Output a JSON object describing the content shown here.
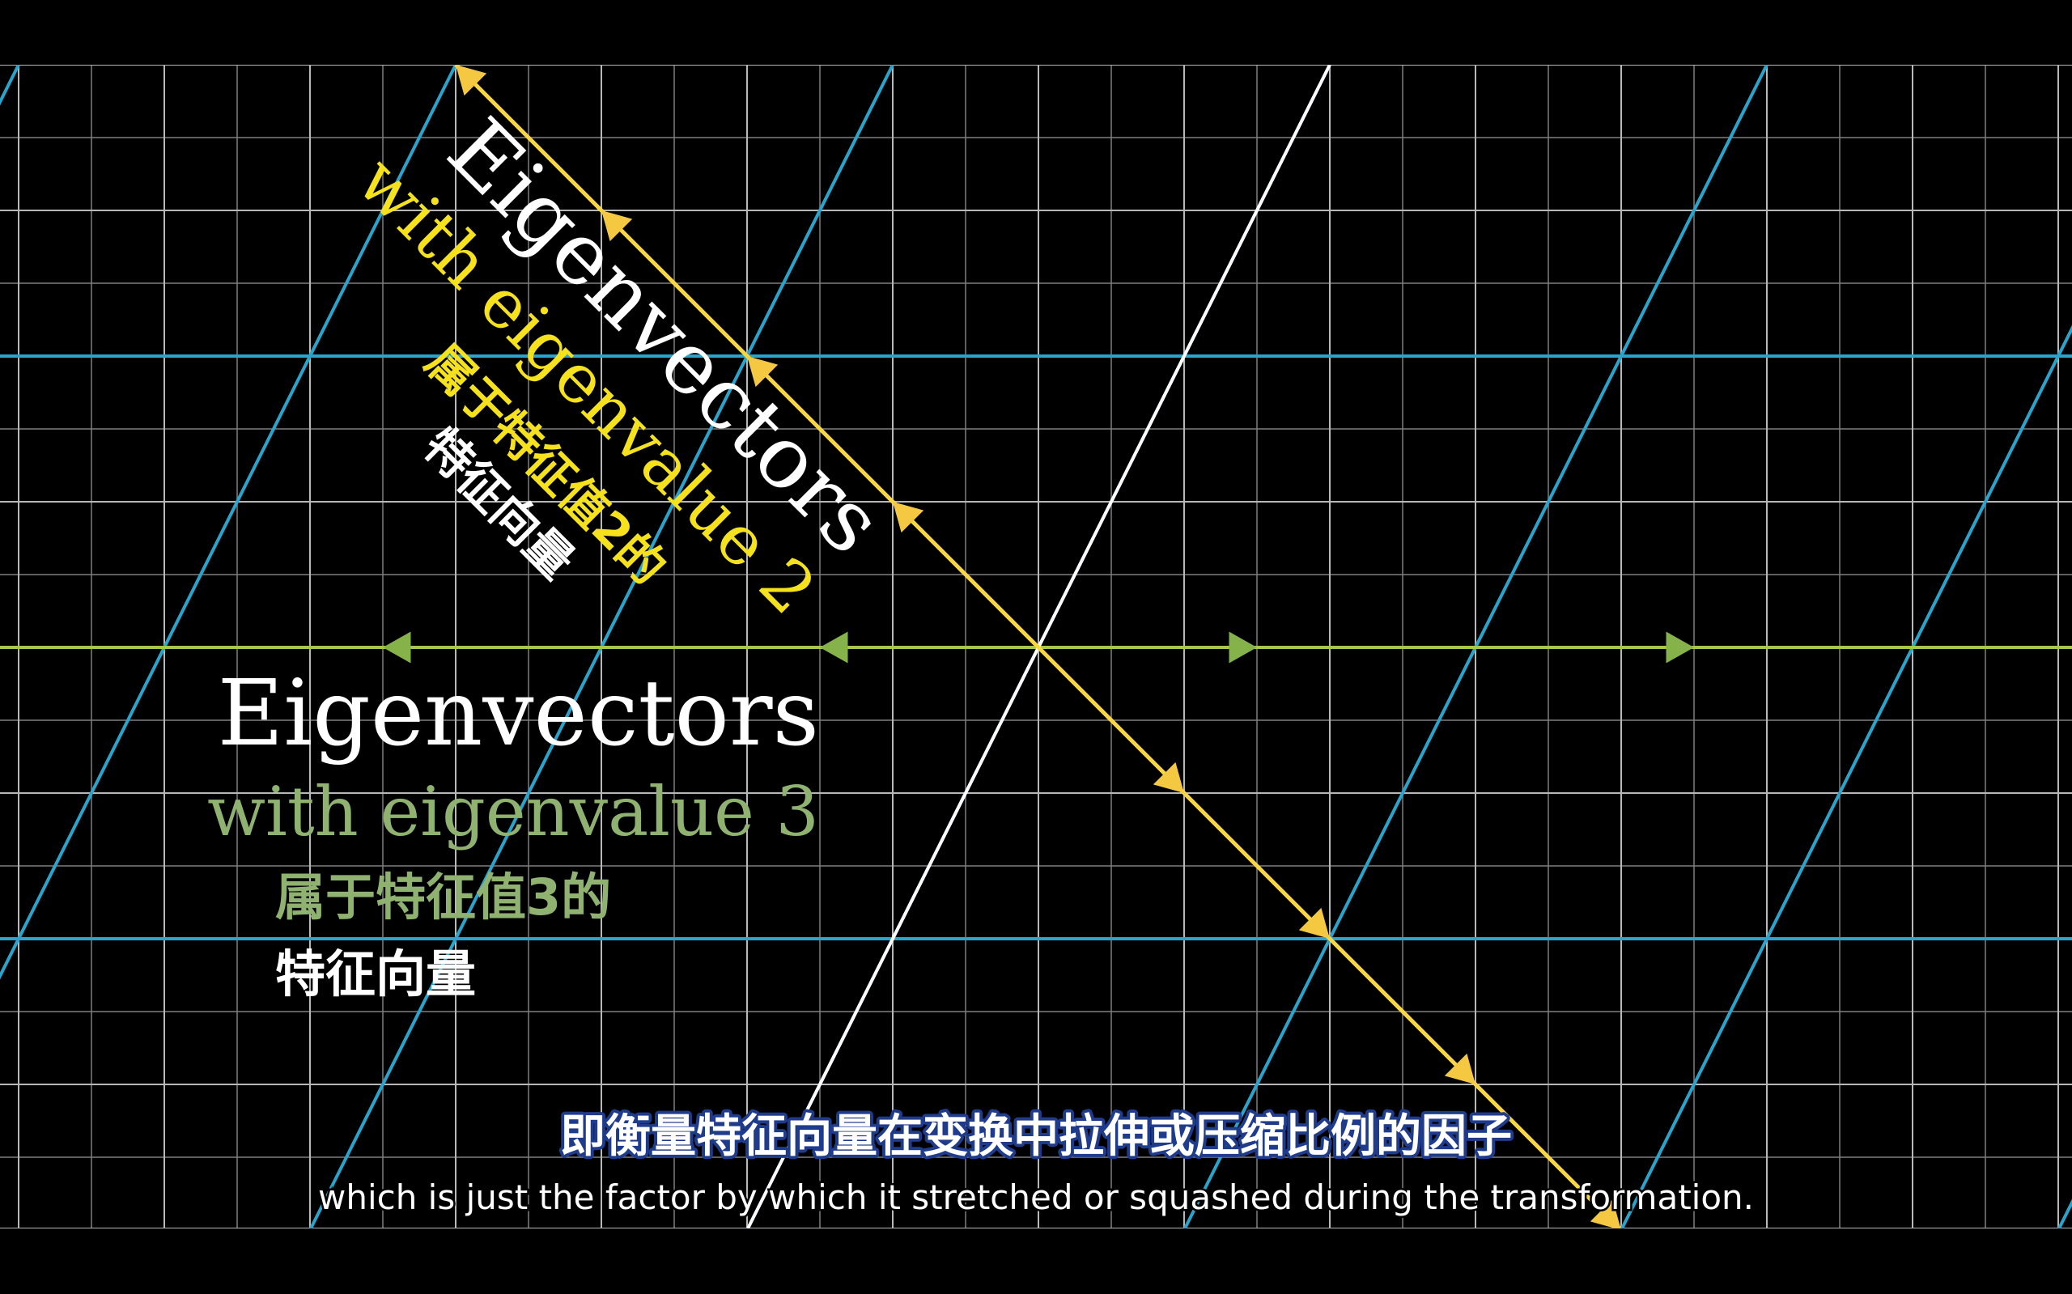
{
  "colors": {
    "background": "#000000",
    "grid_fine": "#7f7f7f",
    "grid_major": "#b8b8b8",
    "transformed_grid": "#29a4cc",
    "eigen_line_3": "#a7c64a",
    "eigen_arrow_3": "#86b24a",
    "eigen_line_2": "#f8d742",
    "eigen_arrow_2": "#f5c842",
    "white_line": "#ffffff",
    "label_yellow": "#f5e21c",
    "label_green": "#8fb270",
    "label_white": "#ffffff",
    "subtitle_outline": "#1f3b8c"
  },
  "eigen_label_2": {
    "title": "Eigenvectors",
    "subtitle": "with eigenvalue 2",
    "cn_line1": "属于特征值2的",
    "cn_line2": "特征向量"
  },
  "eigen_label_3": {
    "title": "Eigenvectors",
    "subtitle": "with eigenvalue 3",
    "cn_line1": "属于特征值3的",
    "cn_line2": "特征向量"
  },
  "subtitles": {
    "zh": "即衡量特征向量在变换中拉伸或压缩比例的因子",
    "en": "which is just the factor by which it stretched or squashed during the transformation."
  }
}
